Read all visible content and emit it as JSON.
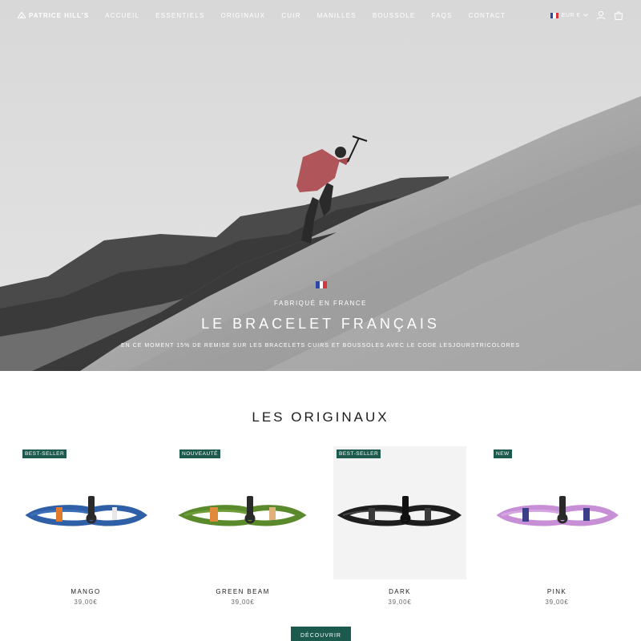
{
  "header": {
    "logo": "PATRICE HILL'S",
    "nav": [
      "ACCUEIL",
      "ESSENTIELS",
      "ORIGINAUX",
      "CUIR",
      "MANILLES",
      "BOUSSOLE",
      "FAQS",
      "CONTACT"
    ],
    "currency": "EUR €"
  },
  "hero": {
    "kicker": "FABRIQUÉ EN FRANCE",
    "title": "LE BRACELET FRANÇAIS",
    "promo": "EN CE MOMENT 15% DE REMISE SUR LES BRACELETS CUIRS ET BOUSSOLES AVEC LE CODE LESJOURSTRICOLORES"
  },
  "collection": {
    "title": "LES ORIGINAUX",
    "products": [
      {
        "badge": "BEST-SELLER",
        "name": "MANGO",
        "price": "39,00€",
        "cord_color": "#2f5fa6",
        "accent_color": "#e07a2c"
      },
      {
        "badge": "NOUVEAUTÉ",
        "name": "GREEN BEAM",
        "price": "39,00€",
        "cord_color": "#5b8a2c",
        "accent_color": "#e08a3c"
      },
      {
        "badge": "BEST-SELLER",
        "name": "DARK",
        "price": "39,00€",
        "cord_color": "#1e1e1e",
        "accent_color": "#3a3a3a"
      },
      {
        "badge": "NEW",
        "name": "PINK",
        "price": "39,00€",
        "cord_color": "#c78fd6",
        "accent_color": "#3b3f8a"
      }
    ],
    "cta": "DÉCOUVRIR"
  },
  "colors": {
    "brand_green": "#1d5a4e",
    "text": "#1c1c1c",
    "muted": "#6a6a6a"
  },
  "icons": [
    "logo-mountain-icon",
    "flag-fr-icon",
    "chevron-down-icon",
    "account-icon",
    "cart-icon"
  ]
}
